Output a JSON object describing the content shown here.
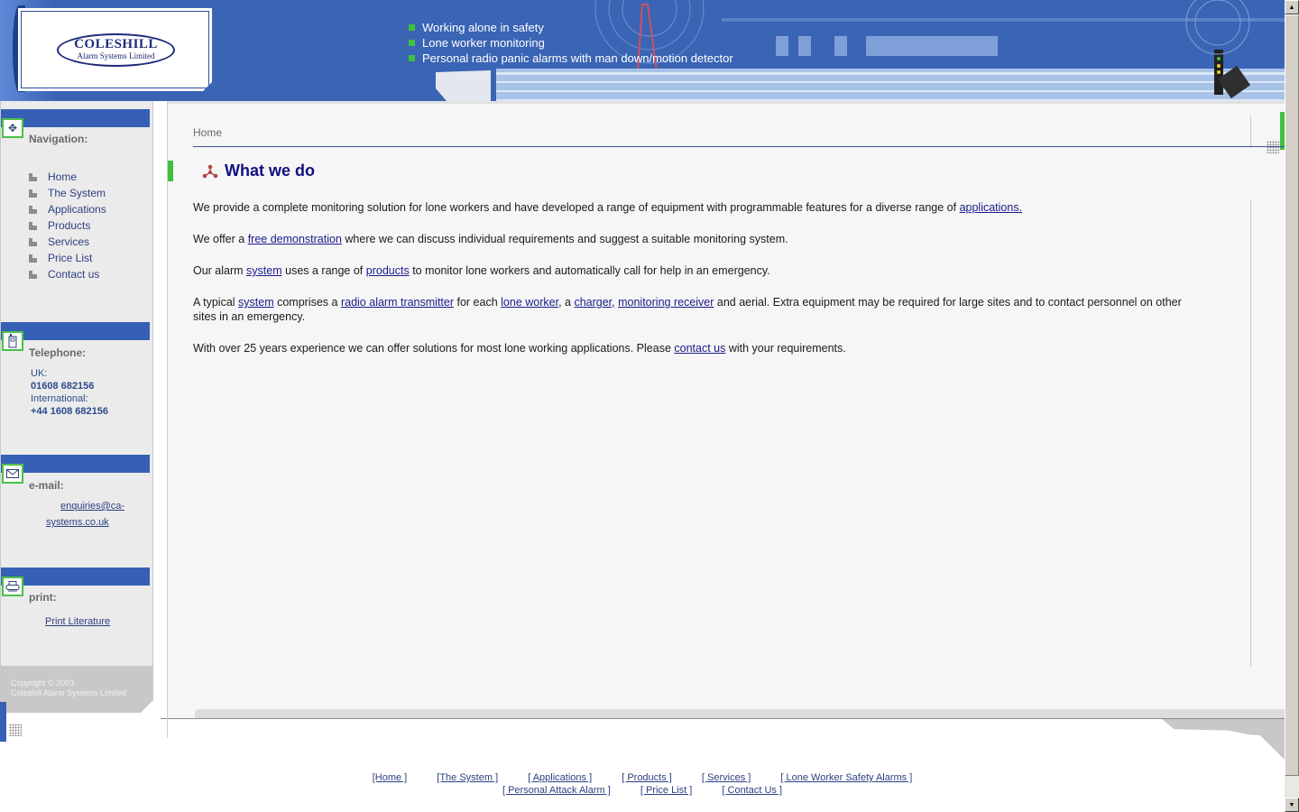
{
  "header": {
    "logo": {
      "name": "COLESHILL",
      "subtitle": "Alarm Systems Limited"
    },
    "taglines": [
      "Working alone in safety",
      "Lone worker monitoring",
      "Personal radio panic alarms with man down/motion detector"
    ],
    "accent_color": "#3fc13f",
    "brand_color": "#3a64b4"
  },
  "sidebar": {
    "navigation": {
      "title": "Navigation:",
      "icon": "move-arrows-icon",
      "items": [
        {
          "label": "Home"
        },
        {
          "label": "The System"
        },
        {
          "label": "Applications"
        },
        {
          "label": "Products"
        },
        {
          "label": "Services"
        },
        {
          "label": "Price List"
        },
        {
          "label": "Contact us"
        }
      ]
    },
    "telephone": {
      "title": "Telephone:",
      "icon": "mobile-phone-icon",
      "uk_label": "UK:",
      "uk_number": "01608 682156",
      "intl_label": "International:",
      "intl_number": "+44 1608 682156"
    },
    "email": {
      "title": "e-mail:",
      "icon": "envelope-icon",
      "address": "enquiries@ca-systems.co.uk"
    },
    "print": {
      "title": "print:",
      "icon": "printer-icon",
      "link": "Print Literature"
    },
    "copyright": {
      "line1": "Copyright © 2003",
      "line2": "Coleshill Alarm Systems Limited"
    }
  },
  "main": {
    "breadcrumb": "Home",
    "heading": "What we do",
    "paragraphs": {
      "p1": {
        "t1": "We provide a complete monitoring solution for lone workers and have developed a range of equipment with programmable features for a diverse range of ",
        "l1": "applications."
      },
      "p2": {
        "t1": "We offer a ",
        "l1": "free demonstration",
        "t2": " where we can discuss individual requirements and suggest a suitable monitoring system."
      },
      "p3": {
        "t1": "Our alarm ",
        "l1": "system",
        "t2": " uses a range of ",
        "l2": "products",
        "t3": " to monitor lone workers and automatically call for help in an emergency."
      },
      "p4": {
        "t1": "A typical ",
        "l1": "system",
        "t2": " comprises a ",
        "l2": "radio alarm transmitter",
        "t3": " for each ",
        "l3": "lone worker",
        "t4": ", a ",
        "l4": "charger,",
        "t5": " ",
        "l5": "monitoring receiver",
        "t6": " and aerial. Extra equipment may be required for large sites and to contact personnel on other sites in an emergency."
      },
      "p5": {
        "t1": "With over 25 years experience we can offer solutions for most lone working applications. Please ",
        "l1": "contact us",
        "t2": " with your requirements."
      }
    }
  },
  "footer": {
    "row1": [
      "[Home ]",
      "[The System ]",
      "[ Applications ]",
      "[ Products ]",
      "[ Services ]",
      "[ Lone Worker Safety Alarms ]"
    ],
    "row2": [
      "[ Personal Attack Alarm ]",
      "[ Price List ]",
      "[ Contact Us ]"
    ]
  }
}
